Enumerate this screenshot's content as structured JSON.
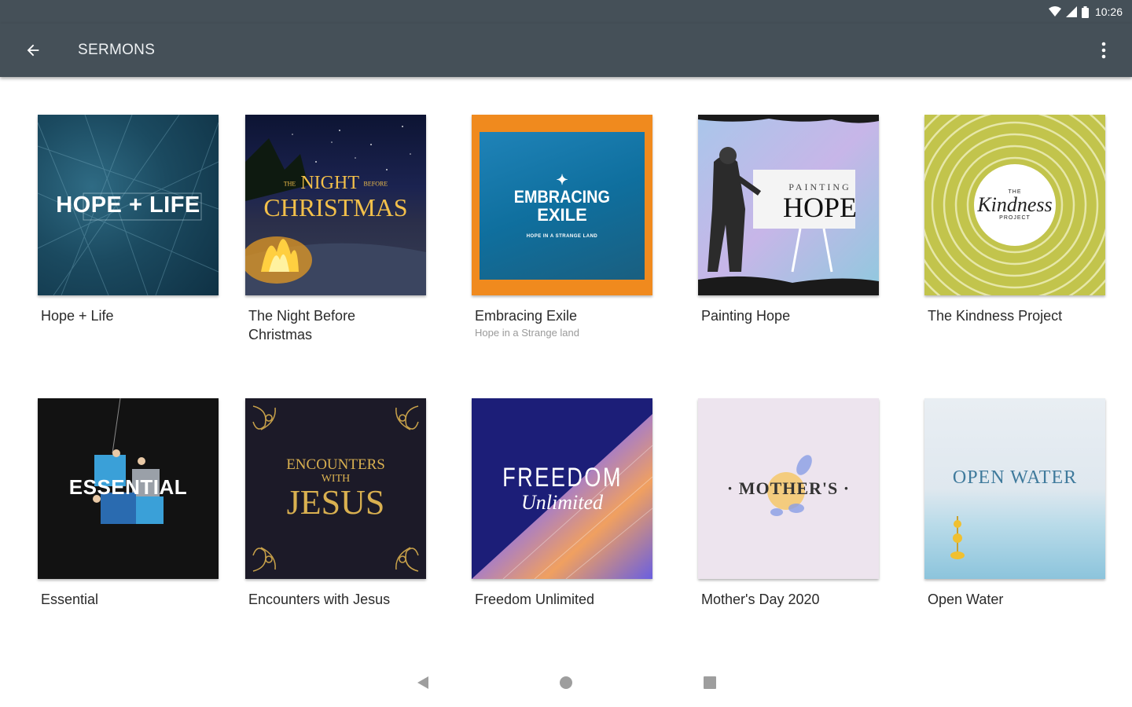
{
  "status_bar": {
    "time": "10:26"
  },
  "app_bar": {
    "title": "SERMONS"
  },
  "sermons": [
    {
      "title": "Hope + Life",
      "subtitle": "",
      "art": {
        "line1": "HOPE + LIFE"
      }
    },
    {
      "title": "The Night Before Christmas",
      "subtitle": "",
      "art": {
        "line1": "THE",
        "line2": "NIGHT",
        "line3": "BEFORE",
        "line4": "CHRISTMAS"
      }
    },
    {
      "title": "Embracing Exile",
      "subtitle": "Hope in a Strange land",
      "art": {
        "line1": "EMBRACING",
        "line2": "EXILE",
        "line3": "HOPE IN A STRANGE LAND"
      }
    },
    {
      "title": "Painting Hope",
      "subtitle": "",
      "art": {
        "line1": "PAINTING",
        "line2": "HOPE"
      }
    },
    {
      "title": "The Kindness Project",
      "subtitle": "",
      "art": {
        "line1": "THE",
        "line2": "Kindness",
        "line3": "PROJECT"
      }
    },
    {
      "title": "Essential",
      "subtitle": "",
      "art": {
        "line1": "ESSENTIAL"
      }
    },
    {
      "title": "Encounters with Jesus",
      "subtitle": "",
      "art": {
        "line1": "ENCOUNTERS",
        "line2": "WITH",
        "line3": "JESUS"
      }
    },
    {
      "title": "Freedom Unlimited",
      "subtitle": "",
      "art": {
        "line1": "FREEDOM",
        "line2": "Unlimited"
      }
    },
    {
      "title": "Mother's Day 2020",
      "subtitle": "",
      "art": {
        "line1": "· MOTHER'S ·"
      }
    },
    {
      "title": "Open Water",
      "subtitle": "",
      "art": {
        "line1": "OPEN WATER"
      }
    }
  ],
  "colors": {
    "app_bar": "#455058",
    "background": "#ffffff"
  },
  "icons": {
    "back": "arrow-back-icon",
    "overflow": "more-vert-icon",
    "wifi": "wifi-icon",
    "signal": "signal-icon",
    "battery": "battery-icon",
    "nav_back": "nav-back-icon",
    "nav_home": "nav-home-icon",
    "nav_recents": "nav-recents-icon"
  }
}
